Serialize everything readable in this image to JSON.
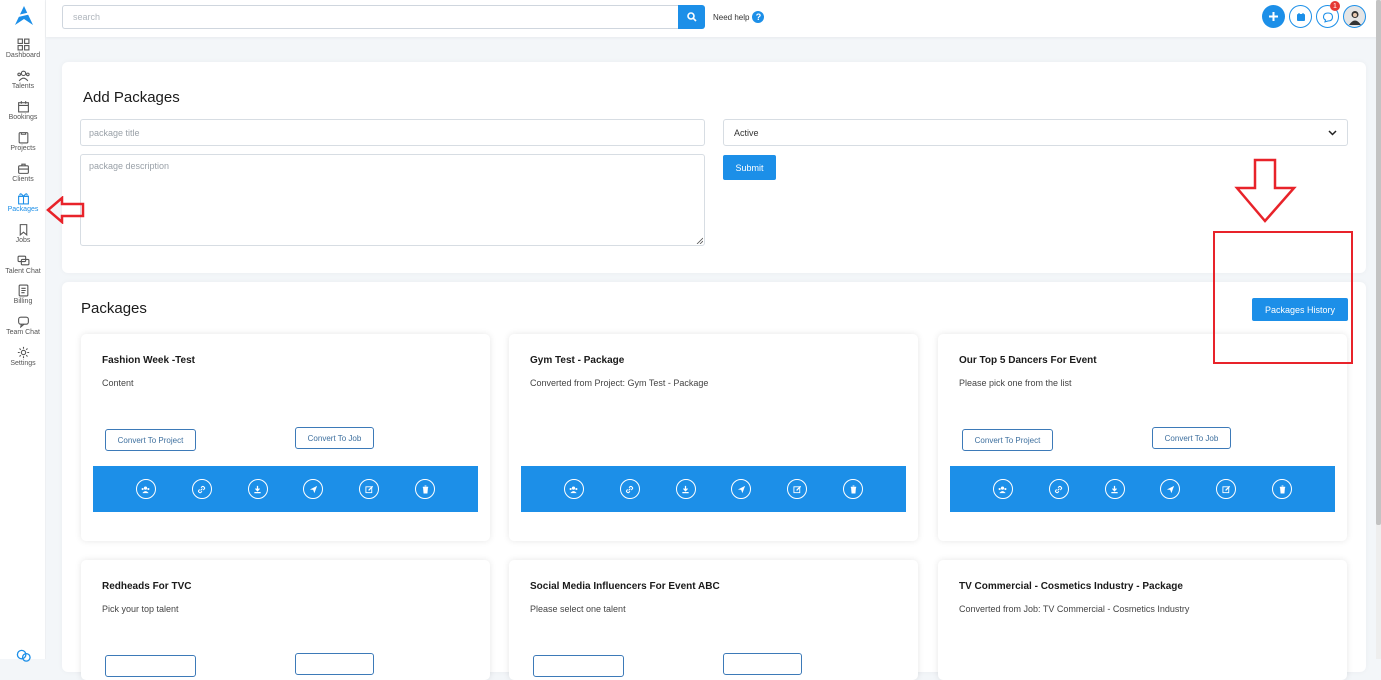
{
  "sidebar": {
    "items": [
      {
        "label": "Dashboard",
        "icon": "dashboard-icon"
      },
      {
        "label": "Talents",
        "icon": "users-icon"
      },
      {
        "label": "Bookings",
        "icon": "calendar-icon"
      },
      {
        "label": "Projects",
        "icon": "projects-icon"
      },
      {
        "label": "Clients",
        "icon": "briefcase-icon"
      },
      {
        "label": "Packages",
        "icon": "gift-icon",
        "active": true
      },
      {
        "label": "Jobs",
        "icon": "bookmark-icon"
      },
      {
        "label": "Talent Chat",
        "icon": "chat-icon"
      },
      {
        "label": "Billing",
        "icon": "billing-icon"
      },
      {
        "label": "Team Chat",
        "icon": "team-chat-icon"
      },
      {
        "label": "Settings",
        "icon": "gear-icon"
      }
    ]
  },
  "topbar": {
    "search_placeholder": "search",
    "help_label": "Need help",
    "notification_count": "1"
  },
  "add_packages": {
    "title": "Add Packages",
    "title_placeholder": "package title",
    "description_placeholder": "package description",
    "status_value": "Active",
    "submit_label": "Submit"
  },
  "packages": {
    "title": "Packages",
    "history_label": "Packages History",
    "convert_project_label": "Convert To Project",
    "convert_job_label": "Convert To Job",
    "items": [
      {
        "title": "Fashion Week -Test",
        "desc": "Content"
      },
      {
        "title": "Gym Test - Package",
        "desc": "Converted from Project: Gym Test - Package"
      },
      {
        "title": "Our Top 5 Dancers For Event",
        "desc": "Please pick one from the list"
      },
      {
        "title": "Redheads For TVC",
        "desc": "Pick your top talent"
      },
      {
        "title": "Social Media Influencers For Event ABC",
        "desc": "Please select one talent"
      },
      {
        "title": "TV Commercial - Cosmetics Industry - Package",
        "desc": "Converted from Job: TV Commercial - Cosmetics Industry"
      }
    ]
  },
  "colors": {
    "accent": "#1c8fe8",
    "annotation": "#e8232a"
  }
}
